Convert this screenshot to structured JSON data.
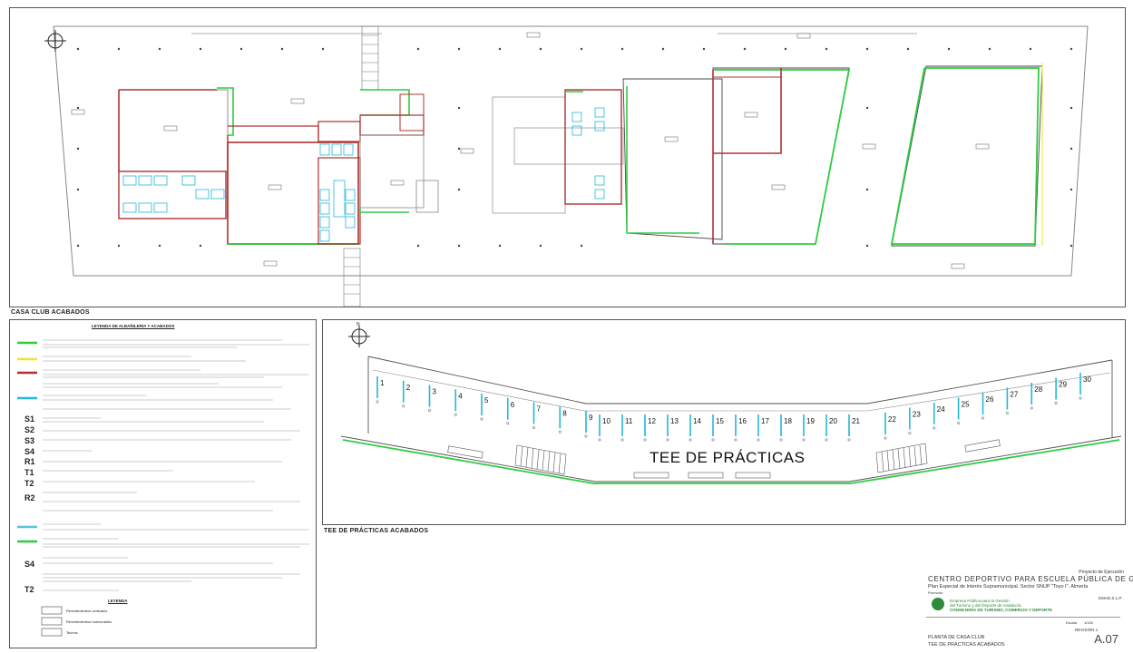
{
  "captions": {
    "top": "CASA CLUB ACABADOS",
    "bottom": "TEE DE PRÁCTICAS ACABADOS"
  },
  "tee": {
    "title": "TEE DE PRÁCTICAS",
    "bay_numbers": [
      "1",
      "2",
      "3",
      "4",
      "5",
      "6",
      "7",
      "8",
      "9",
      "10",
      "11",
      "12",
      "13",
      "14",
      "15",
      "16",
      "17",
      "18",
      "19",
      "20",
      "21",
      "22",
      "23",
      "24",
      "25",
      "26",
      "27",
      "28",
      "29",
      "30"
    ]
  },
  "legend": {
    "heading": "LEYENDA DE ALBAÑILERÍA Y ACABADOS",
    "codes": [
      "S1",
      "S2",
      "S3",
      "S4",
      "R1",
      "T1",
      "T2",
      "R2",
      "S4",
      "T2"
    ],
    "colors": {
      "green": "#2ecc40",
      "yellow": "#f1e22f",
      "red": "#b03030",
      "cyan": "#22b8d8",
      "lightblue": "#5bc0de"
    },
    "footer_heading": "LEYENDA",
    "footer_items": [
      "Revestimientos verticales",
      "Revestimientos horizontales",
      "Techos"
    ]
  },
  "title_block": {
    "project_label": "Proyecto de Ejecución",
    "project_title": "CENTRO DEPORTIVO PARA ESCUELA PÚBLICA DE GOLF",
    "subtitle": "Plan Especial de Interés Supramunicipal. Sector SNUP \"Toyo I\". Almería",
    "promoter_label": "Promotor",
    "client": "EMAD.S.L.P.",
    "agency1": "Empresa Pública para la Gestión",
    "agency2": "del Turismo y del Deporte de Andalucía",
    "agency3": "CONSEJERÍA DE TURISMO, COMERCIO Y DEPORTE",
    "plan_title1": "PLANTA DE CASA CLUB",
    "plan_title2": "TEE DE PRÁCTICAS ACABADOS",
    "scale_label": "Escala",
    "scale": "1/150",
    "revision": "REVISIÓN 1",
    "sheet": "A.07"
  }
}
